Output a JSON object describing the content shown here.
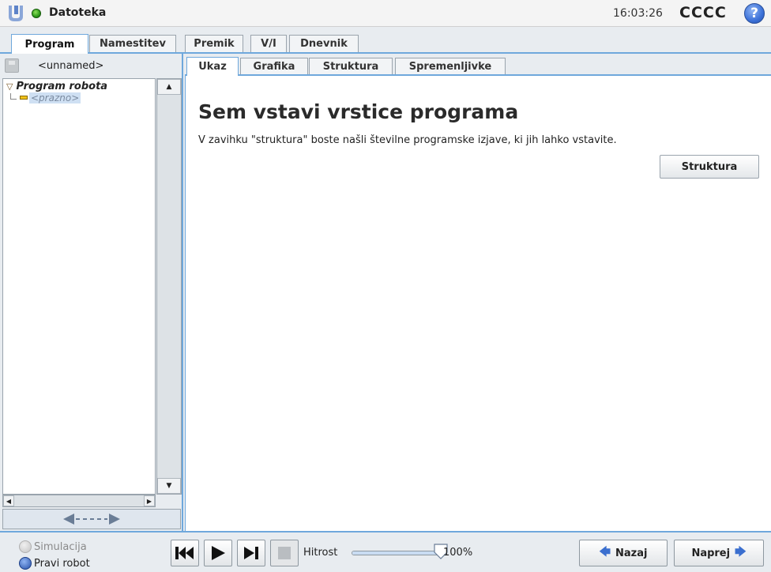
{
  "titlebar": {
    "file_menu": "Datoteka",
    "time": "16:03:26",
    "robot_name": "CCCC",
    "help_label": "?"
  },
  "top_tabs": [
    {
      "label": "Program",
      "active": true
    },
    {
      "label": "Namestitev",
      "active": false
    },
    {
      "label": "Premik",
      "active": false
    },
    {
      "label": "V/I",
      "active": false
    },
    {
      "label": "Dnevnik",
      "active": false
    }
  ],
  "left_panel": {
    "program_name": "<unnamed>",
    "tree_root": "Program robota",
    "tree_child": "<prazno>"
  },
  "sub_tabs": [
    {
      "label": "Ukaz",
      "active": true
    },
    {
      "label": "Grafika",
      "active": false
    },
    {
      "label": "Struktura",
      "active": false
    },
    {
      "label": "Spremenljivke",
      "active": false
    }
  ],
  "content": {
    "heading": "Sem vstavi vrstice programa",
    "text": "V zavihku \"struktura\" boste našli številne programske izjave, ki jih lahko vstavite.",
    "struktura_button": "Struktura"
  },
  "bottom": {
    "mode_simulation": "Simulacija",
    "mode_real": "Pravi robot",
    "speed_label": "Hitrost",
    "speed_value": "100%",
    "speed_percent": 100,
    "back_button": "Nazaj",
    "next_button": "Naprej"
  },
  "colors": {
    "accent": "#6fa8dc",
    "status_ok": "#2e9a1a",
    "help": "#3c71d8"
  }
}
